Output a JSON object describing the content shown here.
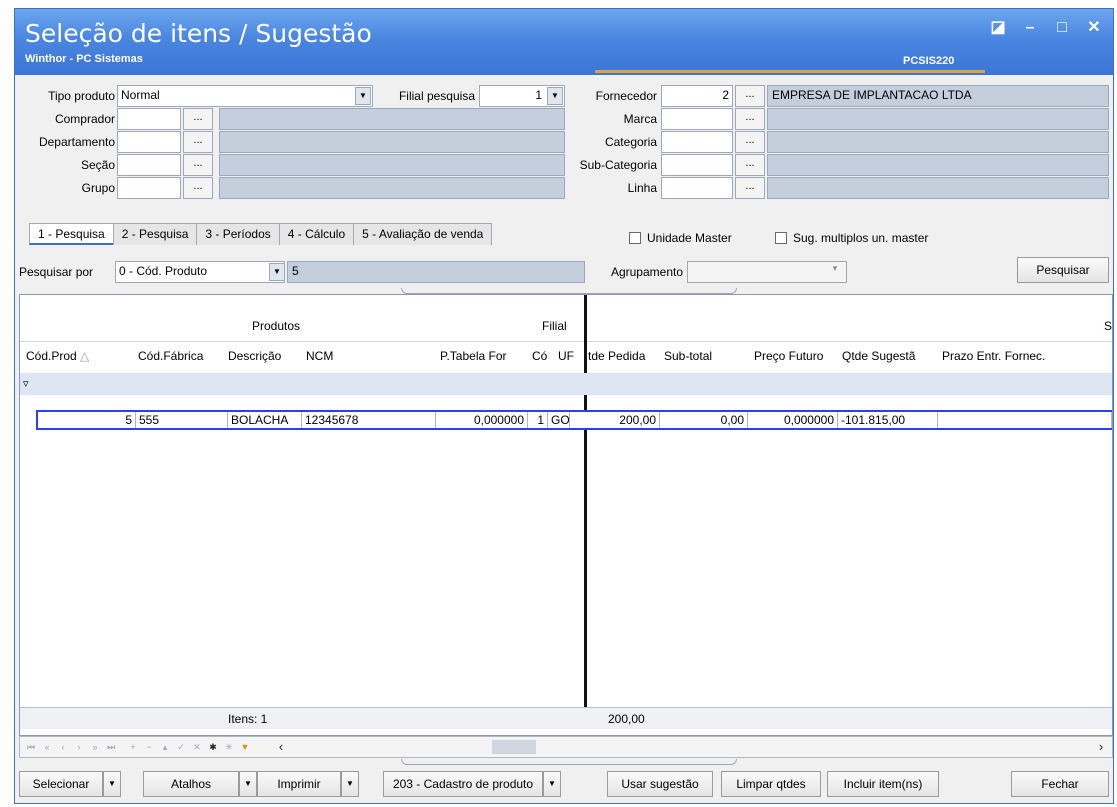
{
  "window": {
    "title": "Seleção de itens / Sugestão",
    "subtitle": "Winthor - PC Sistemas",
    "code": "PCSIS220",
    "buttons": [
      "◪",
      "–",
      "□",
      "✕"
    ]
  },
  "form": {
    "tipo_produto": {
      "label": "Tipo produto",
      "value": "Normal"
    },
    "filial_pesquisa": {
      "label": "Filial pesquisa",
      "value": "1"
    },
    "fornecedor": {
      "label": "Fornecedor",
      "code": "2",
      "name": "EMPRESA DE IMPLANTACAO LTDA"
    },
    "comprador": {
      "label": "Comprador"
    },
    "departamento": {
      "label": "Departamento"
    },
    "secao": {
      "label": "Seção"
    },
    "grupo": {
      "label": "Grupo"
    },
    "marca": {
      "label": "Marca"
    },
    "categoria": {
      "label": "Categoria"
    },
    "subcategoria": {
      "label": "Sub-Categoria"
    },
    "linha": {
      "label": "Linha"
    },
    "dots": "..."
  },
  "tabs": [
    "1 - Pesquisa",
    "2 - Pesquisa",
    "3 - Períodos",
    "4 - Cálculo",
    "5 - Avaliação de venda"
  ],
  "checks": {
    "unidade_master": "Unidade Master",
    "sug_multiplos": "Sug. multiplos un. master"
  },
  "search": {
    "label": "Pesquisar por",
    "by": "0 - Cód. Produto",
    "value": "5",
    "agrupamento_label": "Agrupamento",
    "button": "Pesquisar"
  },
  "grid": {
    "band_produtos": "Produtos",
    "band_filial": "Filial",
    "band_s": "S",
    "columns": [
      "Cód.Prod",
      "Cód.Fábrica",
      "Descrição",
      "NCM",
      "P.Tabela For",
      "Có",
      "UF",
      "tde Pedida",
      "Sub-total",
      "Preço Futuro",
      "Qtde Sugestã",
      "Prazo Entr. Fornec."
    ],
    "rows": [
      {
        "cod": "5",
        "fabrica": "555",
        "descricao": "BOLACHA",
        "ncm": "12345678",
        "ptabela": "0,000000",
        "co": "1",
        "uf": "GO",
        "pedida": "200,00",
        "subtotal": "0,00",
        "futuro": "0,000000",
        "sugestao": "-101.815,00",
        "prazo": ""
      }
    ],
    "footer_items": "Itens: 1",
    "footer_total": "200,00"
  },
  "bottom_buttons": {
    "selecionar": "Selecionar",
    "atalhos": "Atalhos",
    "imprimir": "Imprimir",
    "cadastro": "203 - Cadastro de produto",
    "usar_sugestao": "Usar sugestão",
    "limpar_qtdes": "Limpar qtdes",
    "incluir_itens": "Incluir item(ns)",
    "fechar": "Fechar"
  },
  "colors": {
    "title_blue": "#4a86e0",
    "field_gray": "#c4cedd",
    "selection_border": "#2e3ef2",
    "accent": "#d9a441"
  }
}
